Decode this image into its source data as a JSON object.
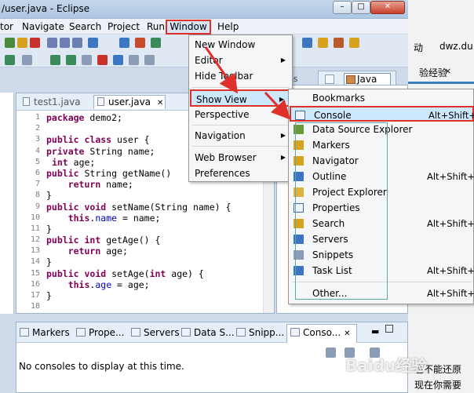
{
  "window": {
    "title": "/user.java - Eclipse"
  },
  "menubar": {
    "items": [
      "tor",
      "Navigate",
      "Search",
      "Project",
      "Run",
      "Window",
      "Help"
    ]
  },
  "editor": {
    "tabs": [
      "test1.java",
      "user.java"
    ],
    "lines": [
      {
        "n": "1",
        "code": "package demo2;"
      },
      {
        "n": "2",
        "code": ""
      },
      {
        "n": "3",
        "code": "public class user {"
      },
      {
        "n": "4",
        "code": "private String name;"
      },
      {
        "n": "5",
        "code": " int age;"
      },
      {
        "n": "6",
        "code": "public String getName()"
      },
      {
        "n": "7",
        "code": "    return name;"
      },
      {
        "n": "8",
        "code": "}"
      },
      {
        "n": "9",
        "code": "public void setName(String name) {"
      },
      {
        "n": "10",
        "code": "    this.name = name;"
      },
      {
        "n": "11",
        "code": "}"
      },
      {
        "n": "12",
        "code": "public int getAge() {"
      },
      {
        "n": "13",
        "code": "    return age;"
      },
      {
        "n": "14",
        "code": "}"
      },
      {
        "n": "15",
        "code": "public void setAge(int age) {"
      },
      {
        "n": "16",
        "code": "    this.age = age;"
      },
      {
        "n": "17",
        "code": "}"
      },
      {
        "n": "18",
        "code": ""
      }
    ]
  },
  "perspective": {
    "partial_tab": "ss",
    "label": "Java EE"
  },
  "window_menu": {
    "items": [
      {
        "label": "New Window",
        "submenu": false
      },
      {
        "label": "Editor",
        "submenu": true
      },
      {
        "label": "Hide Toolbar",
        "submenu": false
      },
      {
        "label": "Show View",
        "submenu": true
      },
      {
        "label": "Perspective",
        "submenu": false
      },
      {
        "label": "Navigation",
        "submenu": true
      },
      {
        "label": "Web Browser",
        "submenu": true
      },
      {
        "label": "Preferences",
        "submenu": false
      }
    ]
  },
  "show_view_menu": {
    "items": [
      {
        "label": "Bookmarks",
        "shortcut": ""
      },
      {
        "label": "Console",
        "shortcut": "Alt+Shift+Q"
      },
      {
        "label": "Data Source Explorer",
        "shortcut": ""
      },
      {
        "label": "Markers",
        "shortcut": ""
      },
      {
        "label": "Navigator",
        "shortcut": ""
      },
      {
        "label": "Outline",
        "shortcut": "Alt+Shift+Q"
      },
      {
        "label": "Project Explorer",
        "shortcut": ""
      },
      {
        "label": "Properties",
        "shortcut": ""
      },
      {
        "label": "Search",
        "shortcut": "Alt+Shift+Q"
      },
      {
        "label": "Servers",
        "shortcut": ""
      },
      {
        "label": "Snippets",
        "shortcut": ""
      },
      {
        "label": "Task List",
        "shortcut": "Alt+Shift+Q"
      },
      {
        "label": "Other...",
        "shortcut": "Alt+Shift+Q"
      }
    ]
  },
  "bottom_views": {
    "tabs": [
      "Markers",
      "Prope...",
      "Servers",
      "Data S...",
      "Snipp...",
      "Conso..."
    ],
    "console_message": "No consoles to display at this time."
  },
  "background_browser": {
    "tab1": "动",
    "tab2": "dwz.du",
    "tab3": "验经验",
    "close": "×",
    "text1": "也不能还原",
    "text2": "现在你需要"
  },
  "watermark": "Baidu经验"
}
